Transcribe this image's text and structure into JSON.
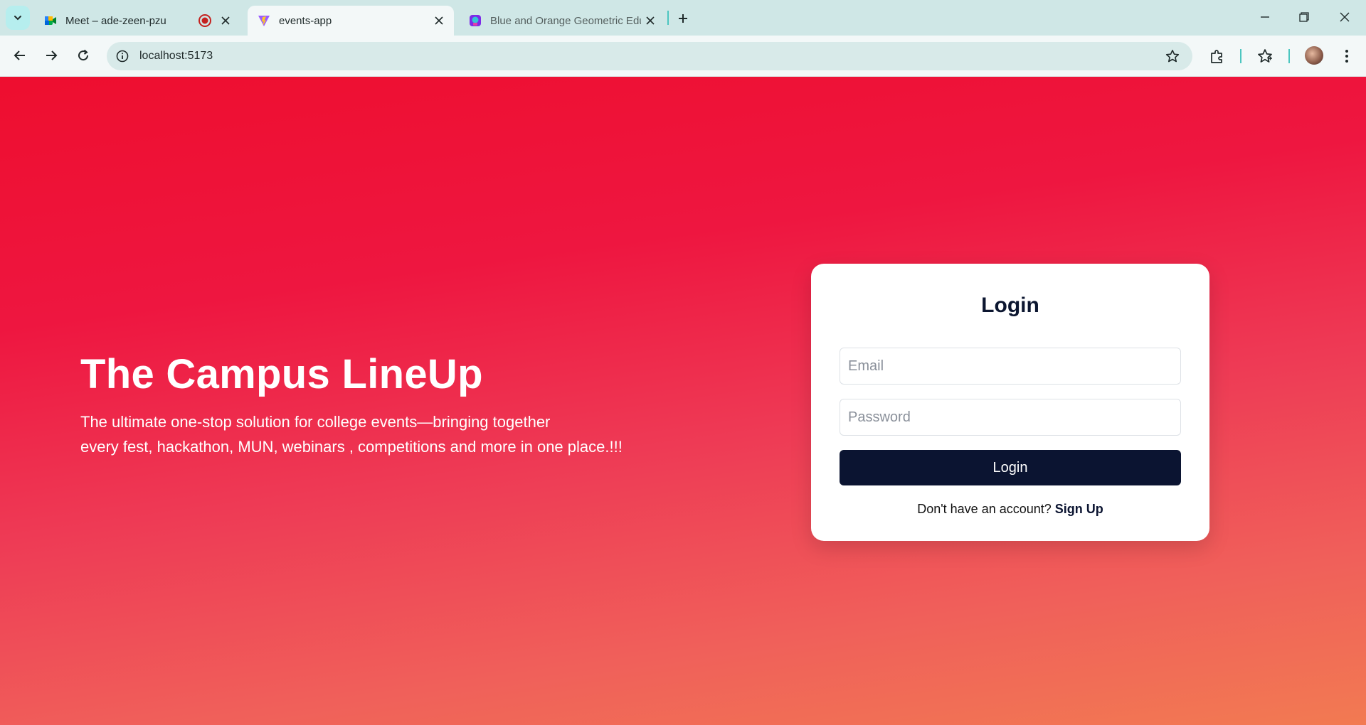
{
  "browser": {
    "tabs": [
      {
        "title": "Meet – ade-zeen-pzu",
        "active": false
      },
      {
        "title": "events-app",
        "active": true
      },
      {
        "title": "Blue and Orange Geometric Edu",
        "active": false
      }
    ],
    "url": "localhost:5173"
  },
  "hero": {
    "title": "The Campus LineUp",
    "subtitle_line1": "The ultimate one-stop solution for college events—bringing together",
    "subtitle_line2": "every fest, hackathon, MUN, webinars , competitions and more in one place.!!!"
  },
  "login": {
    "title": "Login",
    "email_placeholder": "Email",
    "password_placeholder": "Password",
    "submit_label": "Login",
    "signup_prompt": "Don't have an account?",
    "signup_link": "Sign Up"
  },
  "colors": {
    "accent_dark": "#0b1431",
    "gradient_top": "#ee0e2f",
    "gradient_bottom": "#f27a52",
    "tabstrip": "#cfe7e6"
  },
  "icons": [
    "tab-search-icon",
    "meet-icon",
    "recording-icon",
    "vite-icon",
    "canva-icon",
    "close-icon",
    "plus-icon",
    "minimize-icon",
    "restore-icon",
    "back-arrow-icon",
    "forward-arrow-icon",
    "reload-icon",
    "info-icon",
    "star-icon",
    "extensions-icon",
    "bookmarks-icon",
    "avatar",
    "menu-icon"
  ]
}
